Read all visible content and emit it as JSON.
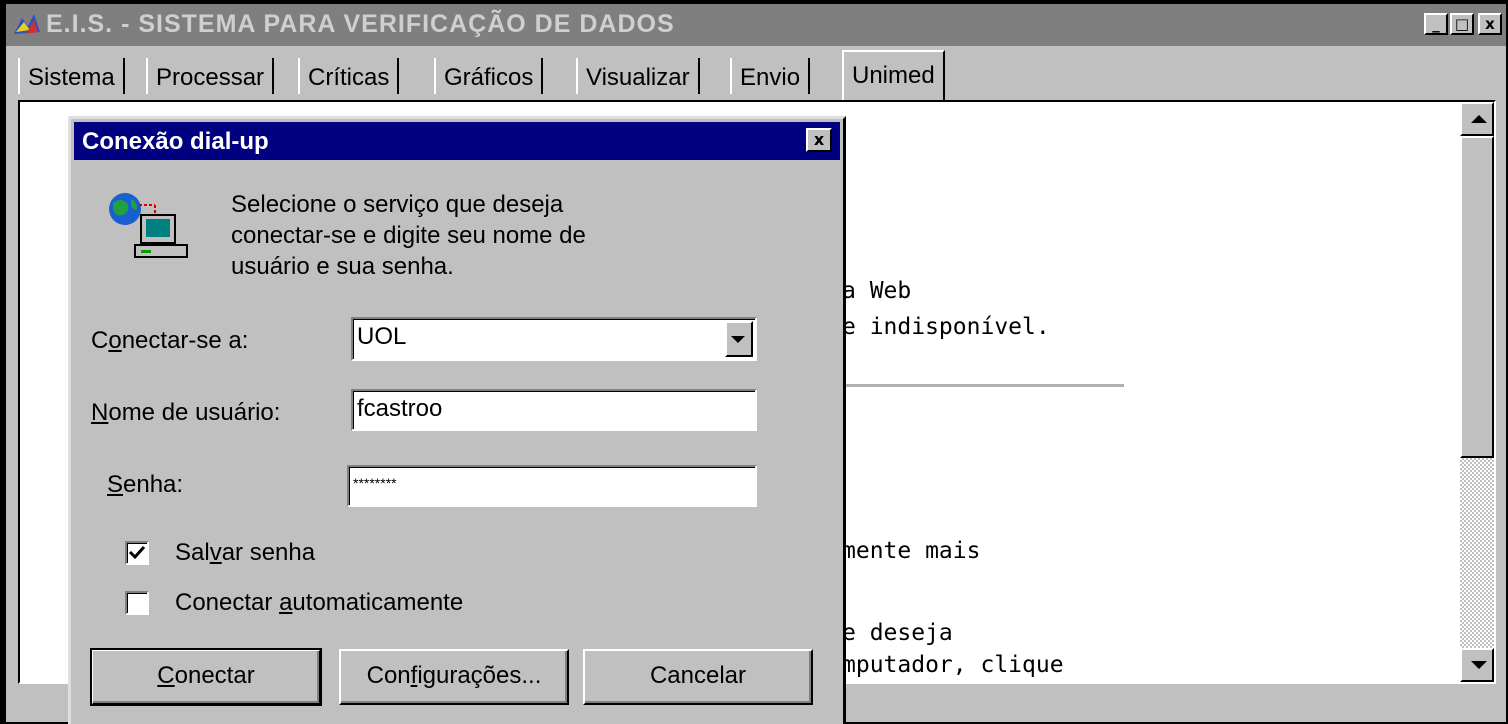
{
  "window": {
    "title": "E.I.S. - SISTEMA PARA VERIFICAÇÃO DE DADOS",
    "minimize_symbol": "_",
    "maximize_symbol": "□",
    "close_symbol": "x"
  },
  "tabs": [
    {
      "label": "Sistema"
    },
    {
      "label": "Processar"
    },
    {
      "label": "Críticas"
    },
    {
      "label": "Gráficos"
    },
    {
      "label": "Visualizar"
    },
    {
      "label": "Envio"
    },
    {
      "label": "Unimed",
      "active": true
    }
  ],
  "background_page": {
    "lines": [
      "a Web",
      "e indisponível.",
      "mente mais",
      "e deseja",
      "mputador, clique"
    ]
  },
  "dialog": {
    "title": "Conexão dial-up",
    "close_symbol": "x",
    "icon": "dialup-network-computer-icon",
    "message": [
      "Selecione o serviço que deseja",
      "conectar-se e digite seu nome de",
      "usuário e sua senha."
    ],
    "connect_to": {
      "label_pre": "C",
      "label_ul": "o",
      "label_post": "nectar-se a:",
      "value": "UOL"
    },
    "username": {
      "label_pre": "",
      "label_ul": "N",
      "label_post": "ome de usuário:",
      "value": "fcastroo"
    },
    "password": {
      "label_pre": "",
      "label_ul": "S",
      "label_post": "enha:",
      "value": "********"
    },
    "save_password": {
      "label_pre": "Sal",
      "label_ul": "v",
      "label_post": "ar senha",
      "checked": true
    },
    "auto_connect": {
      "label_pre": "Conectar ",
      "label_ul": "a",
      "label_post": "utomaticamente",
      "checked": false
    },
    "buttons": {
      "connect": {
        "pre": "",
        "ul": "C",
        "post": "onectar"
      },
      "settings": {
        "pre": "Con",
        "ul": "f",
        "post": "igurações..."
      },
      "cancel": {
        "pre": "Cancelar",
        "ul": "",
        "post": ""
      }
    }
  }
}
